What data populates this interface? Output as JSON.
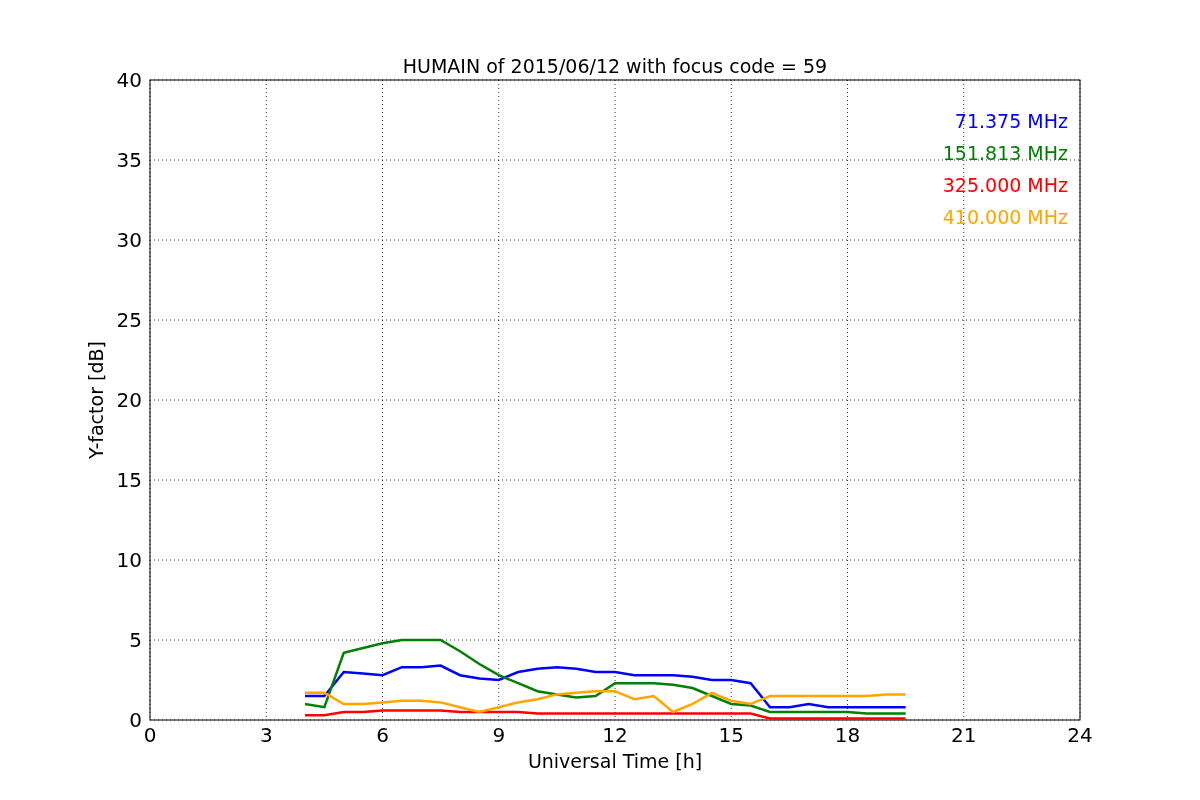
{
  "chart_data": {
    "type": "line",
    "title": "HUMAIN of 2015/06/12 with focus code = 59",
    "xlabel": "Universal Time [h]",
    "ylabel": "Y-factor [dB]",
    "x": [
      4,
      4.5,
      5,
      5.5,
      6,
      6.5,
      7,
      7.5,
      8,
      8.5,
      9,
      9.5,
      10,
      10.5,
      11,
      11.5,
      12,
      12.5,
      13,
      13.5,
      14,
      14.5,
      15,
      15.5,
      16,
      16.5,
      17,
      17.5,
      18,
      18.5,
      19,
      19.5
    ],
    "series": [
      {
        "name": "71.375 MHz",
        "color": "#0000ff",
        "values": [
          1.5,
          1.5,
          3.0,
          2.9,
          2.8,
          3.3,
          3.3,
          3.4,
          2.8,
          2.6,
          2.5,
          3.0,
          3.2,
          3.3,
          3.2,
          3.0,
          3.0,
          2.8,
          2.8,
          2.8,
          2.7,
          2.5,
          2.5,
          2.3,
          0.8,
          0.8,
          1.0,
          0.8,
          0.8,
          0.8,
          0.8,
          0.8
        ]
      },
      {
        "name": "151.813 MHz",
        "color": "#008000",
        "values": [
          1.0,
          0.8,
          4.2,
          4.5,
          4.8,
          5.0,
          5.0,
          5.0,
          4.3,
          3.5,
          2.8,
          2.3,
          1.8,
          1.6,
          1.4,
          1.5,
          2.3,
          2.3,
          2.3,
          2.2,
          2.0,
          1.5,
          1.0,
          0.9,
          0.5,
          0.5,
          0.5,
          0.5,
          0.5,
          0.4,
          0.4,
          0.4
        ]
      },
      {
        "name": "325.000 MHz",
        "color": "#ff0000",
        "values": [
          0.3,
          0.3,
          0.5,
          0.5,
          0.6,
          0.6,
          0.6,
          0.6,
          0.5,
          0.5,
          0.5,
          0.5,
          0.4,
          0.4,
          0.4,
          0.4,
          0.4,
          0.4,
          0.4,
          0.4,
          0.4,
          0.4,
          0.4,
          0.4,
          0.1,
          0.1,
          0.1,
          0.1,
          0.1,
          0.1,
          0.1,
          0.1
        ]
      },
      {
        "name": "410.000 MHz",
        "color": "#ffa500",
        "values": [
          1.7,
          1.7,
          1.0,
          1.0,
          1.1,
          1.2,
          1.2,
          1.1,
          0.8,
          0.5,
          0.8,
          1.1,
          1.3,
          1.6,
          1.7,
          1.8,
          1.8,
          1.3,
          1.5,
          0.5,
          1.0,
          1.7,
          1.2,
          1.0,
          1.5,
          1.5,
          1.5,
          1.5,
          1.5,
          1.5,
          1.6,
          1.6
        ]
      }
    ],
    "xlim": [
      0,
      24
    ],
    "ylim": [
      0,
      40
    ],
    "xticks": [
      0,
      3,
      6,
      9,
      12,
      15,
      18,
      21,
      24
    ],
    "yticks": [
      0,
      5,
      10,
      15,
      20,
      25,
      30,
      35,
      40
    ],
    "grid": true
  }
}
